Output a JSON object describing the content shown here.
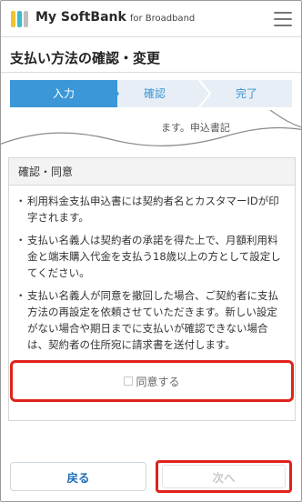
{
  "header": {
    "brand": "My SoftBank",
    "brand_sub": "for Broadband"
  },
  "page": {
    "title": "支払い方法の確認・変更"
  },
  "steps": [
    {
      "label": "入力"
    },
    {
      "label": "確認"
    },
    {
      "label": "完了"
    }
  ],
  "torn_fragment": "ます。申込書記",
  "agreement": {
    "heading": "確認・同意",
    "notes": [
      "利用料金支払申込書には契約者名とカスタマーIDが印字されます。",
      "支払い名義人は契約者の承諾を得た上で、月額利用料金と端末購入代金を支払う18歳以上の方として設定してください。",
      "支払い名義人が同意を撤回した場合、ご契約者に支払方法の再設定を依頼させていただきます。新しい設定がない場合や期日までに支払いが確認できない場合は、契約者の住所宛に請求書を送付します。"
    ],
    "checkbox_label": "同意する"
  },
  "buttons": {
    "back": "戻る",
    "next": "次へ"
  },
  "colors": {
    "accent": "#3b97d7",
    "highlight": "#e0221b"
  }
}
